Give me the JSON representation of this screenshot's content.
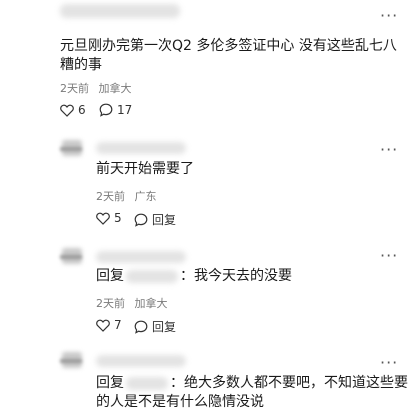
{
  "more_label": "···",
  "top_comment": {
    "text": "元旦刚办完第一次Q2 多伦多签证中心 没有这些乱七八糟的事",
    "time": "2天前",
    "location": "加拿大",
    "likes": "6",
    "replies": "17"
  },
  "replies": [
    {
      "prefix": "",
      "text": "前天开始需要了",
      "time": "2天前",
      "location": "广东",
      "likes": "5",
      "reply_label": "回复"
    },
    {
      "prefix": "回复",
      "text": "：我今天去的没要",
      "time": "2天前",
      "location": "加拿大",
      "likes": "7",
      "reply_label": "回复"
    },
    {
      "prefix": "回复",
      "text_line1": "：绝大多数人都不要吧，不知道这些要",
      "text_line2": "的人是不是有什么隐情没说"
    }
  ]
}
